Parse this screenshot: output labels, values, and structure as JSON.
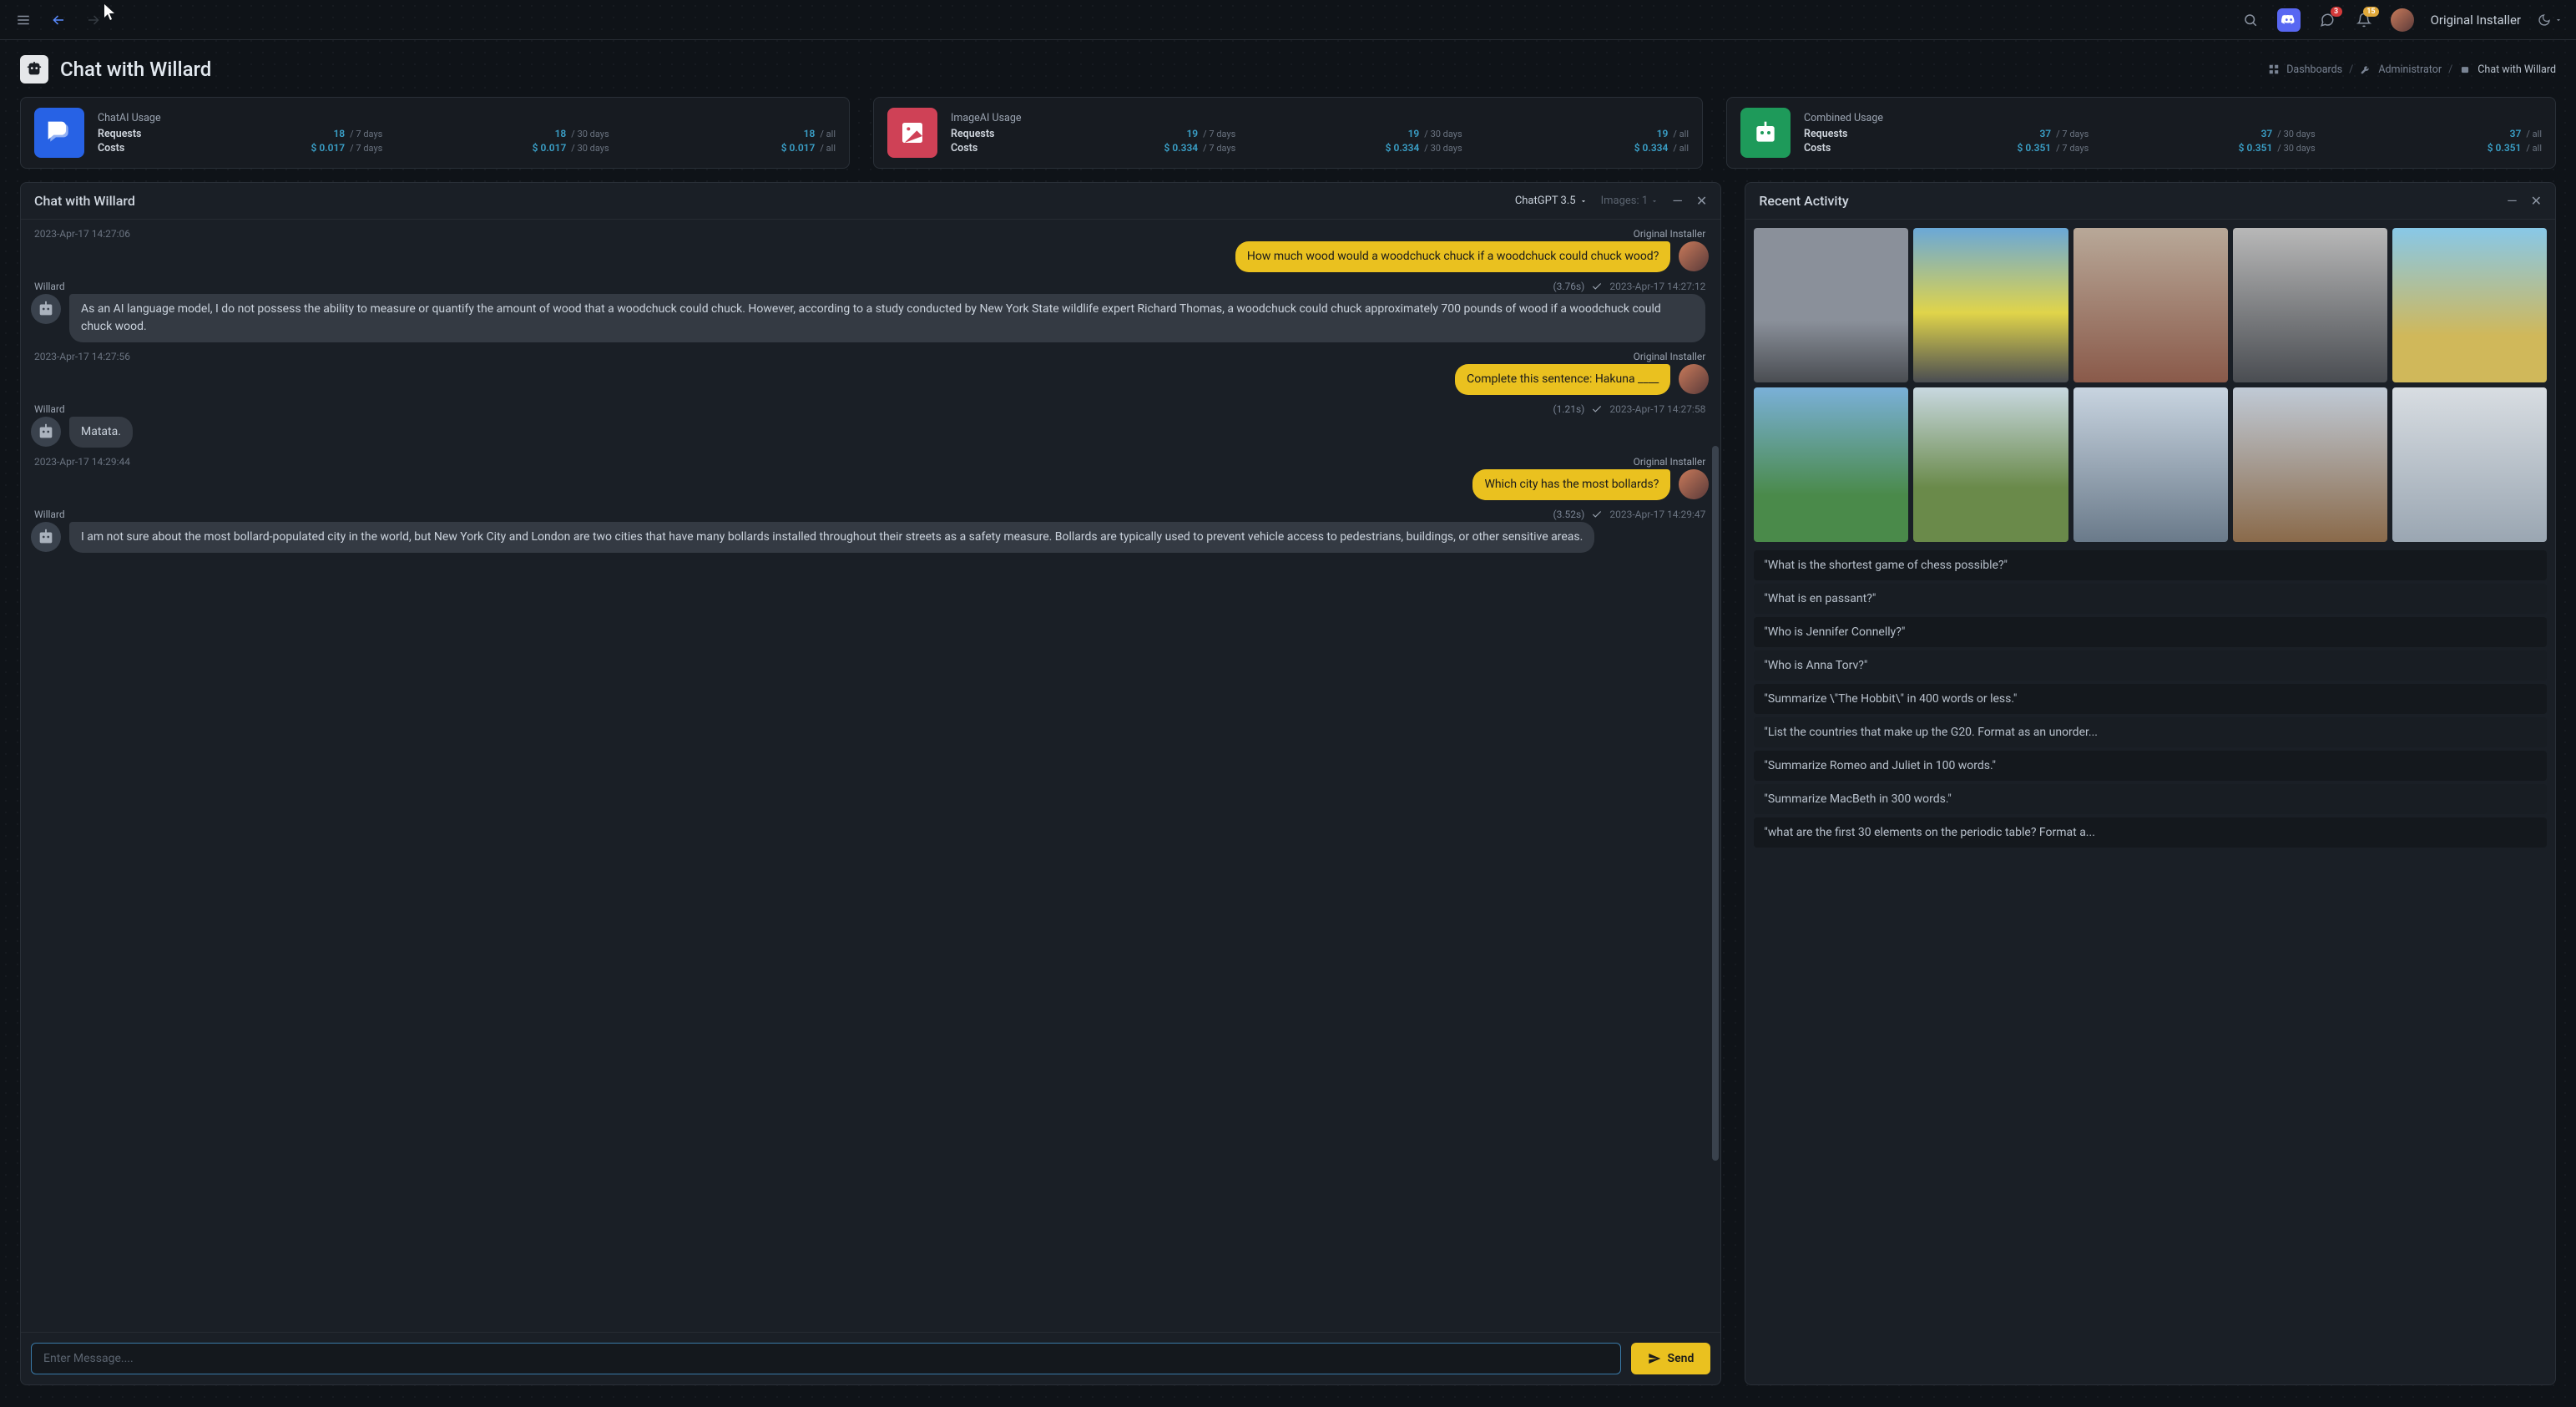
{
  "topbar": {
    "notif_count": "3",
    "bell_count": "15",
    "username": "Original Installer"
  },
  "header": {
    "title": "Chat with Willard"
  },
  "breadcrumb": {
    "dashboards": "Dashboards",
    "admin": "Administrator",
    "current": "Chat with Willard"
  },
  "stats": [
    {
      "title": "ChatAI Usage",
      "icon": "blue",
      "rows": [
        {
          "label": "Requests",
          "v7": "18",
          "v30": "18",
          "vall": "18"
        },
        {
          "label": "Costs",
          "v7": "$ 0.017",
          "v30": "$ 0.017",
          "vall": "$ 0.017"
        }
      ]
    },
    {
      "title": "ImageAI Usage",
      "icon": "red",
      "rows": [
        {
          "label": "Requests",
          "v7": "19",
          "v30": "19",
          "vall": "19"
        },
        {
          "label": "Costs",
          "v7": "$ 0.334",
          "v30": "$ 0.334",
          "vall": "$ 0.334"
        }
      ]
    },
    {
      "title": "Combined Usage",
      "icon": "green",
      "rows": [
        {
          "label": "Requests",
          "v7": "37",
          "v30": "37",
          "vall": "37"
        },
        {
          "label": "Costs",
          "v7": "$ 0.351",
          "v30": "$ 0.351",
          "vall": "$ 0.351"
        }
      ]
    }
  ],
  "periods": {
    "p7": "/ 7 days",
    "p30": "/ 30 days",
    "pall": "/ all"
  },
  "chat": {
    "panel_title": "Chat with Willard",
    "model": "ChatGPT 3.5",
    "images_label": "Images: 1",
    "input_placeholder": "Enter Message....",
    "send_label": "Send",
    "messages": [
      {
        "who": "user",
        "name": "Original Installer",
        "ts_pre": "2023-Apr-17 14:27:06",
        "text": "How much wood would a woodchuck chuck if a woodchuck could chuck wood?"
      },
      {
        "who": "bot",
        "name": "Willard",
        "timing": "(3.76s)",
        "ts": "2023-Apr-17 14:27:12",
        "text": "As an AI language model, I do not possess the ability to measure or quantify the amount of wood that a woodchuck could chuck. However, according to a study conducted by New York State wildlife expert Richard Thomas, a woodchuck could chuck approximately 700 pounds of wood if a woodchuck could chuck wood."
      },
      {
        "who": "user",
        "name": "Original Installer",
        "ts_pre": "2023-Apr-17 14:27:56",
        "text": "Complete this sentence: Hakuna ____"
      },
      {
        "who": "bot",
        "name": "Willard",
        "timing": "(1.21s)",
        "ts": "2023-Apr-17 14:27:58",
        "text": "Matata."
      },
      {
        "who": "user",
        "name": "Original Installer",
        "ts_pre": "2023-Apr-17 14:29:44",
        "text": "Which city has the most bollards?"
      },
      {
        "who": "bot",
        "name": "Willard",
        "timing": "(3.52s)",
        "ts": "2023-Apr-17 14:29:47",
        "text": "I am not sure about the most bollard-populated city in the world, but New York City and London are two cities that have many bollards installed throughout their streets as a safety measure. Bollards are typically used to prevent vehicle access to pedestrians, buildings, or other sensitive areas."
      }
    ]
  },
  "activity": {
    "title": "Recent Activity",
    "prompts": [
      "\"What is the shortest game of chess possible?\"",
      "\"What is en passant?\"",
      "\"Who is Jennifer Connelly?\"",
      "\"Who is Anna Torv?\"",
      "\"Summarize \\\"The Hobbit\\\" in 400 words or less.\"",
      "\"List the countries that make up the G20. Format as an unorder...",
      "\"Summarize Romeo and Juliet in 100 words.\"",
      "\"Summarize MacBeth in 300 words.\"",
      "\"what are the first 30 elements on the periodic table? Format a..."
    ]
  }
}
